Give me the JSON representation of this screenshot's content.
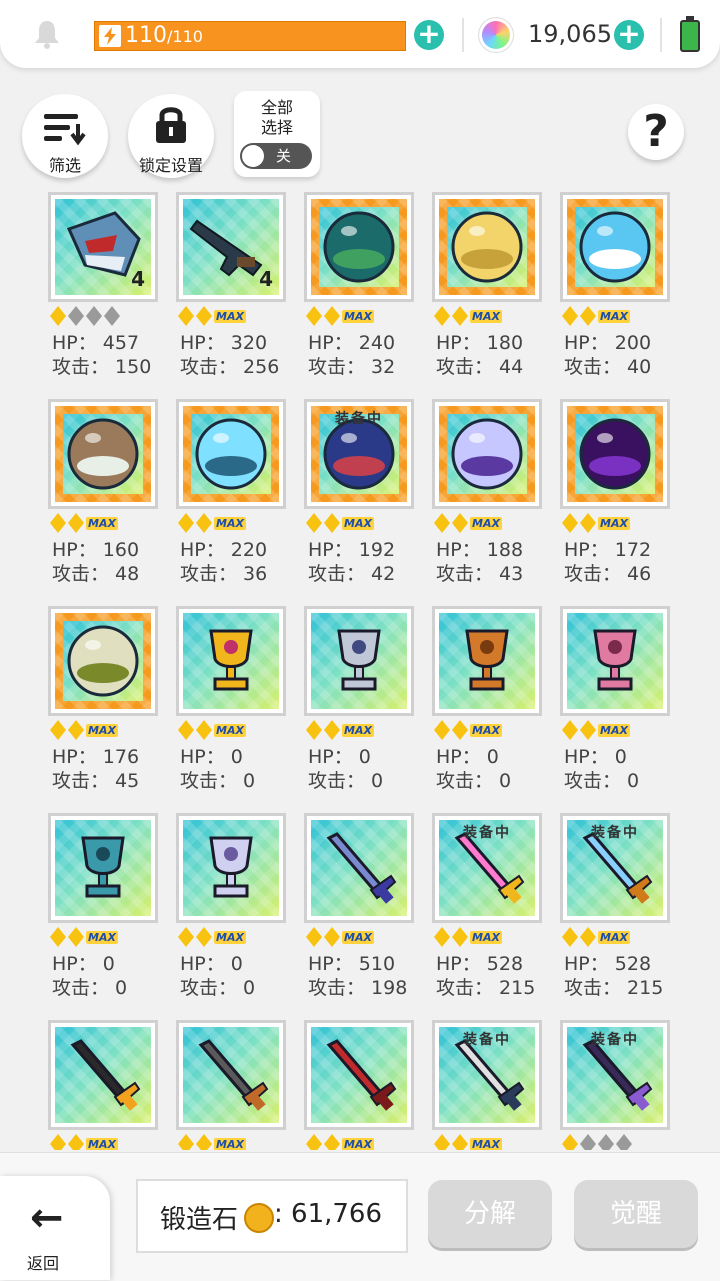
{
  "header": {
    "energy_current": "110",
    "energy_max": "/110",
    "energy_fraction": 1.0,
    "gems": "19,065"
  },
  "toolbar": {
    "filter_label": "筛选",
    "lock_label": "锁定设置",
    "select_all_label": "全部选择",
    "toggle_label": "关"
  },
  "items": [
    {
      "stars": "g1e3",
      "max": false,
      "hp": "HP： 457",
      "atk": "攻击： 150",
      "qty": "4",
      "equipped": false,
      "art": "shark",
      "bg": "diam"
    },
    {
      "stars": "g2",
      "max": true,
      "hp": "HP： 320",
      "atk": "攻击： 256",
      "qty": "4",
      "equipped": false,
      "art": "gun",
      "bg": "diam"
    },
    {
      "stars": "g2",
      "max": true,
      "hp": "HP： 240",
      "atk": "攻击： 32",
      "equipped": false,
      "art": "orb-sea",
      "bg": "orb"
    },
    {
      "stars": "g2",
      "max": true,
      "hp": "HP： 180",
      "atk": "攻击： 44",
      "equipped": false,
      "art": "orb-sand",
      "bg": "orb"
    },
    {
      "stars": "g2",
      "max": true,
      "hp": "HP： 200",
      "atk": "攻击： 40",
      "equipped": false,
      "art": "orb-ship",
      "bg": "orb"
    },
    {
      "stars": "g2",
      "max": true,
      "hp": "HP： 160",
      "atk": "攻击： 48",
      "equipped": false,
      "art": "orb-rock",
      "bg": "orb"
    },
    {
      "stars": "g2",
      "max": true,
      "hp": "HP： 220",
      "atk": "攻击： 36",
      "equipped": false,
      "art": "orb-ice",
      "bg": "orb"
    },
    {
      "stars": "g2",
      "max": true,
      "hp": "HP： 192",
      "atk": "攻击： 42",
      "equipped": true,
      "art": "orb-night",
      "bg": "orb"
    },
    {
      "stars": "g2",
      "max": true,
      "hp": "HP： 188",
      "atk": "攻击： 43",
      "equipped": false,
      "art": "orb-purple",
      "bg": "orb"
    },
    {
      "stars": "g2",
      "max": true,
      "hp": "HP： 172",
      "atk": "攻击： 46",
      "equipped": false,
      "art": "orb-dark",
      "bg": "orb"
    },
    {
      "stars": "g2",
      "max": true,
      "hp": "HP： 176",
      "atk": "攻击： 45",
      "equipped": false,
      "art": "orb-desert",
      "bg": "orb"
    },
    {
      "stars": "g2",
      "max": true,
      "hp": "HP： 0",
      "atk": "攻击： 0",
      "equipped": false,
      "art": "trophy-gold",
      "bg": "diam"
    },
    {
      "stars": "g2",
      "max": true,
      "hp": "HP： 0",
      "atk": "攻击： 0",
      "equipped": false,
      "art": "trophy-silver",
      "bg": "diam"
    },
    {
      "stars": "g2",
      "max": true,
      "hp": "HP： 0",
      "atk": "攻击： 0",
      "equipped": false,
      "art": "trophy-bronze",
      "bg": "diam"
    },
    {
      "stars": "g2",
      "max": true,
      "hp": "HP： 0",
      "atk": "攻击： 0",
      "equipped": false,
      "art": "trophy-pink",
      "bg": "diam"
    },
    {
      "stars": "g2",
      "max": true,
      "hp": "HP： 0",
      "atk": "攻击： 0",
      "equipped": false,
      "art": "trophy-teal",
      "bg": "diam"
    },
    {
      "stars": "g2",
      "max": true,
      "hp": "HP： 0",
      "atk": "攻击： 0",
      "equipped": false,
      "art": "trophy-wings",
      "bg": "diam"
    },
    {
      "stars": "g2",
      "max": true,
      "hp": "HP： 510",
      "atk": "攻击： 198",
      "equipped": false,
      "art": "sword-blue",
      "bg": "diam"
    },
    {
      "stars": "g2",
      "max": true,
      "hp": "HP： 528",
      "atk": "攻击： 215",
      "equipped": true,
      "art": "sword-rainbow",
      "bg": "diam"
    },
    {
      "stars": "g2",
      "max": true,
      "hp": "HP： 528",
      "atk": "攻击： 215",
      "equipped": true,
      "art": "sword-crystal",
      "bg": "diam"
    },
    {
      "stars": "g2",
      "max": true,
      "hp": "",
      "atk": "",
      "equipped": false,
      "art": "scythe",
      "bg": "diam"
    },
    {
      "stars": "g2",
      "max": true,
      "hp": "",
      "atk": "",
      "equipped": false,
      "art": "crossed-swords",
      "bg": "diam"
    },
    {
      "stars": "g2",
      "max": true,
      "hp": "",
      "atk": "",
      "equipped": false,
      "art": "cleaver",
      "bg": "diam"
    },
    {
      "stars": "g2",
      "max": true,
      "hp": "",
      "atk": "",
      "equipped": true,
      "art": "scimitar",
      "bg": "diam"
    },
    {
      "stars": "g1e3",
      "max": false,
      "hp": "",
      "atk": "",
      "equipped": true,
      "art": "dark-sword",
      "bg": "diam"
    }
  ],
  "labels": {
    "equipped": "装备中",
    "max": "MAX"
  },
  "footer": {
    "back_label": "返回",
    "stone_label": "锻造石",
    "stone_value": "61,766",
    "disassemble_label": "分解",
    "awaken_label": "觉醒"
  }
}
